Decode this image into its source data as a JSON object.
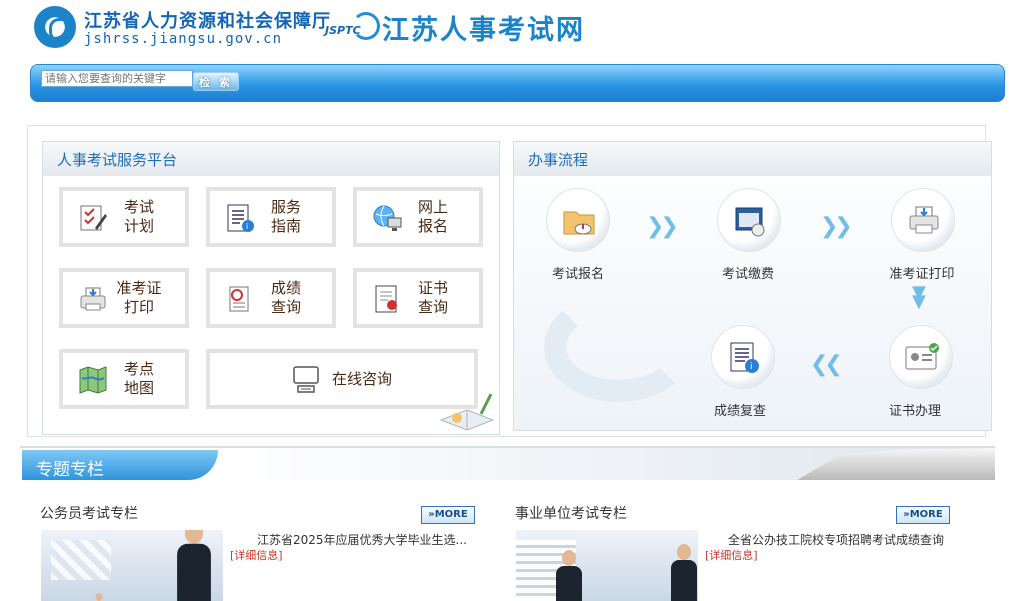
{
  "header": {
    "dept_name": "江苏省人力资源和社会保障厅",
    "dept_url": "jshrss.jiangsu.gov.cn",
    "site_abbr": "JSPTC",
    "site_name": "江苏人事考试网"
  },
  "search": {
    "placeholder": "请输入您要查询的关键字",
    "button_label": "检 索"
  },
  "service_panel": {
    "title": "人事考试服务平台",
    "tiles": [
      {
        "line1": "考试",
        "line2": "计划"
      },
      {
        "line1": "服务",
        "line2": "指南"
      },
      {
        "line1": "网上",
        "line2": "报名"
      },
      {
        "line1": "准考证",
        "line2": "打印"
      },
      {
        "line1": "成绩",
        "line2": "查询"
      },
      {
        "line1": "证书",
        "line2": "查询"
      },
      {
        "line1": "考点",
        "line2": "地图"
      },
      {
        "line1": "在线咨询",
        "line2": ""
      }
    ]
  },
  "flow_panel": {
    "title": "办事流程",
    "steps": [
      "考试报名",
      "考试缴费",
      "准考证打印",
      "证书办理",
      "成绩复查"
    ]
  },
  "special": {
    "title": "专题专栏",
    "columns": [
      {
        "title": "公务员考试专栏",
        "more": "MORE",
        "news_title": "江苏省2025年应届优秀大学毕业生选...",
        "detail": "[详细信息]"
      },
      {
        "title": "事业单位考试专栏",
        "more": "MORE",
        "news_title": "全省公办技工院校专项招聘考试成绩查询",
        "detail": "[详细信息]"
      }
    ]
  },
  "colors": {
    "brand_blue": "#1b84c8",
    "title_blue": "#1a6fba",
    "tile_text": "#4a2a14",
    "detail_red": "#c0392b"
  }
}
